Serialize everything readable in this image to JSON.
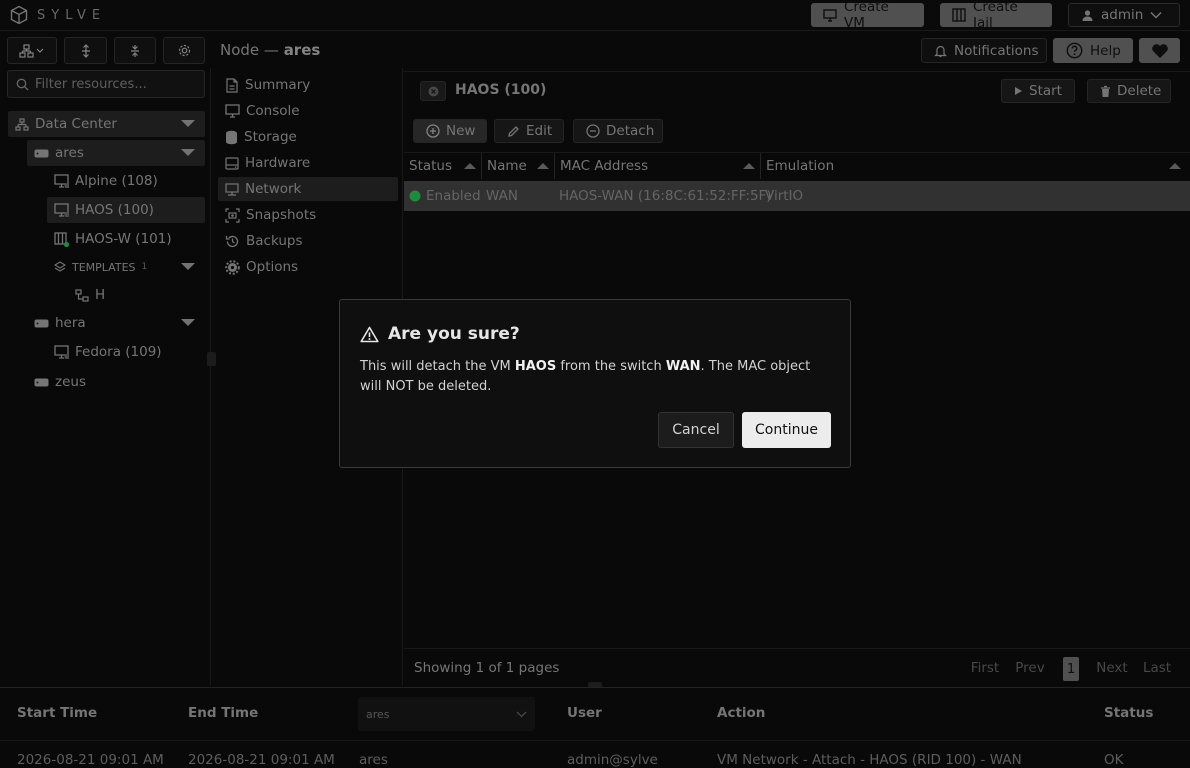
{
  "app": {
    "name": "SYLVE"
  },
  "topbar": {
    "create_vm": "Create VM",
    "create_jail": "Create Jail",
    "user": "admin"
  },
  "header": {
    "breadcrumb_prefix": "Node — ",
    "breadcrumb_node": "ares",
    "notifications": "Notifications",
    "help": "Help"
  },
  "search": {
    "placeholder": "Filter resources..."
  },
  "tree": {
    "datacenter": "Data Center",
    "nodes": [
      {
        "name": "ares"
      },
      {
        "name": "hera"
      },
      {
        "name": "zeus"
      }
    ],
    "vms": [
      {
        "label": "Alpine (108)"
      },
      {
        "label": "HAOS (100)"
      },
      {
        "label": "HAOS-W (101)"
      },
      {
        "label": "Fedora (109)"
      }
    ],
    "templates": {
      "label": "TEMPLATES",
      "count": "1",
      "item": "H"
    }
  },
  "nav": {
    "items": [
      {
        "label": "Summary"
      },
      {
        "label": "Console"
      },
      {
        "label": "Storage"
      },
      {
        "label": "Hardware"
      },
      {
        "label": "Network"
      },
      {
        "label": "Snapshots"
      },
      {
        "label": "Backups"
      },
      {
        "label": "Options"
      }
    ]
  },
  "vm_panel": {
    "title": "HAOS (100)",
    "start": "Start",
    "delete": "Delete",
    "new": "New",
    "edit": "Edit",
    "detach": "Detach",
    "columns": [
      "Status",
      "Name",
      "MAC Address",
      "Emulation"
    ],
    "rows": [
      {
        "status": "Enabled",
        "name": "WAN",
        "mac": "HAOS-WAN (16:8C:61:52:FF:5F)",
        "emulation": "VirtIO"
      }
    ],
    "pagination": {
      "info": "Showing 1 of 1 pages",
      "first": "First",
      "prev": "Prev",
      "page": "1",
      "next": "Next",
      "last": "Last"
    }
  },
  "tasks": {
    "columns": {
      "start": "Start Time",
      "end": "End Time",
      "node_filter": "ares",
      "user": "User",
      "action": "Action",
      "status": "Status"
    },
    "rows": [
      {
        "start": "2026-08-21 09:01 AM",
        "end": "2026-08-21 09:01 AM",
        "node": "ares",
        "user": "admin@sylve",
        "action": "VM Network - Attach - HAOS (RID 100) - WAN",
        "status": "OK"
      }
    ]
  },
  "dialog": {
    "title": "Are you sure?",
    "text_1": "This will detach the VM ",
    "vm": "HAOS",
    "text_2": " from the switch ",
    "switch": "WAN",
    "text_3": ". The MAC object will NOT be deleted.",
    "cancel": "Cancel",
    "continue": "Continue"
  },
  "colors": {
    "status_ok": "#22a447",
    "accent_light": "#ececec",
    "button_grey": "#5f5f5f"
  }
}
